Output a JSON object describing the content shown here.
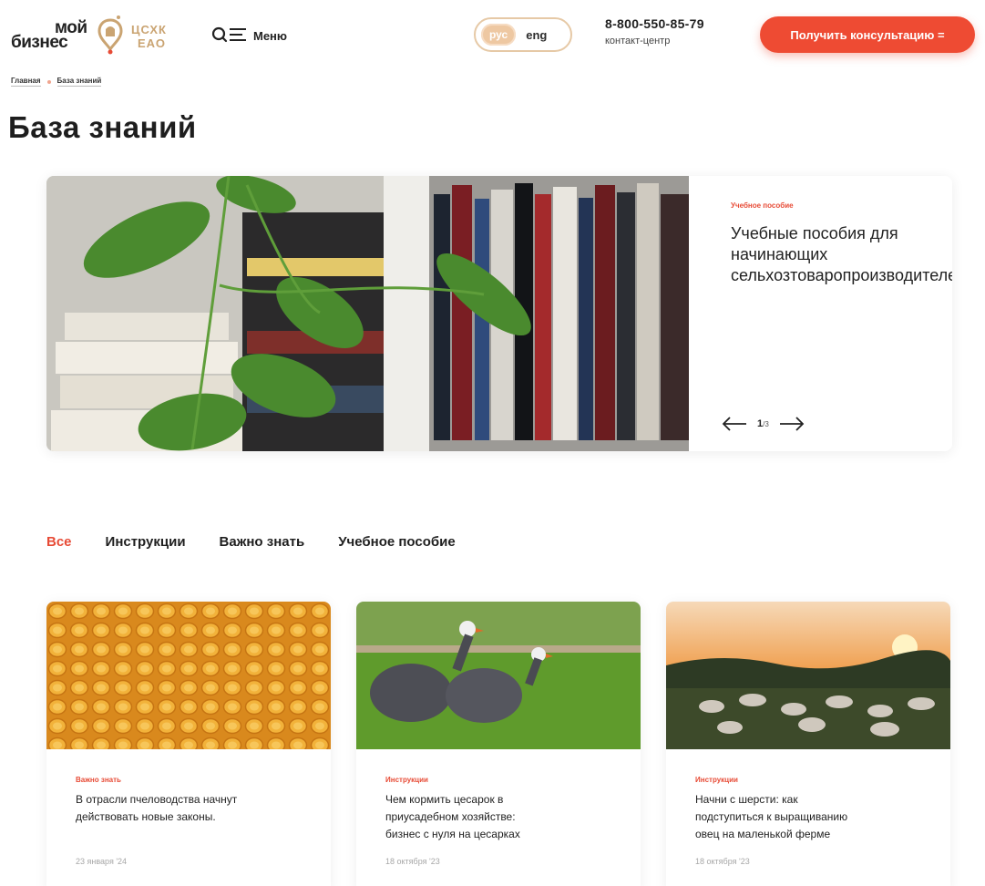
{
  "header": {
    "logo_moy": "мой",
    "logo_biz": "бизнес",
    "logo_org_line1": "ЦСХК",
    "logo_org_line2": "ЕАО",
    "menu_label": "Меню",
    "lang_active": "рус",
    "lang_other": "eng",
    "phone_number": "8-800-550-85-79",
    "phone_caption": "контакт-центр",
    "consult_button": "Получить консультацию ="
  },
  "breadcrumb": {
    "home": "Главная",
    "current": "База знаний"
  },
  "page_title": "База знаний",
  "hero": {
    "tag": "Учебное пособие",
    "title": "Учебные пособия для\nначинающих\nсельхозтоваропроизводителей",
    "counter_current": "1",
    "counter_total": "/3"
  },
  "filters": [
    {
      "label": "Все"
    },
    {
      "label": "Инструкции"
    },
    {
      "label": "Важно знать"
    },
    {
      "label": "Учебное пособие"
    }
  ],
  "cards": [
    {
      "tag": "Важно знать",
      "title": "В отрасли пчеловодства начнут\nдействовать новые законы.",
      "date": "23 января '24"
    },
    {
      "tag": "Инструкции",
      "title": "Чем кормить цесарок в\nприусадебном хозяйстве:\nбизнес с нуля на цесарках",
      "date": "18 октября '23"
    },
    {
      "tag": "Инструкции",
      "title": "Начни с шерсти: как\nподступиться к выращиванию\nовец на маленькой ферме",
      "date": "18 октября '23"
    }
  ],
  "colors": {
    "accent": "#ee4b33",
    "logo_gold": "#caa472",
    "lang_pill": "#eec8a2"
  }
}
